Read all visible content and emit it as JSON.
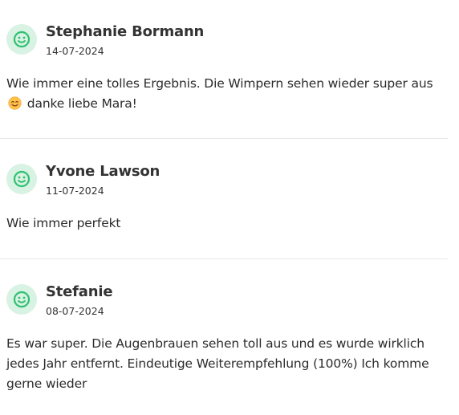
{
  "colors": {
    "avatar_bg": "#d8f2e3",
    "avatar_icon": "#2fc170",
    "text": "#2b2b2b",
    "divider": "#e6e6e6"
  },
  "reviews": [
    {
      "name": "Stephanie Bormann",
      "date": "14-07-2024",
      "avatar_icon": "smiley-face-icon",
      "text_before_emoji": "Wie immer eine tolles Ergebnis. Die Wimpern sehen wieder super aus",
      "emoji": "smiling-face-emoji",
      "text_after_emoji": "danke liebe Mara!"
    },
    {
      "name": "Yvone Lawson",
      "date": "11-07-2024",
      "avatar_icon": "smiley-face-icon",
      "text": "Wie immer perfekt"
    },
    {
      "name": "Stefanie",
      "date": "08-07-2024",
      "avatar_icon": "smiley-face-icon",
      "text": "Es war super. Die Augenbrauen sehen toll aus und es wurde wirklich jedes Jahr entfernt. Eindeutige Weiterempfehlung (100%) Ich komme gerne wieder"
    }
  ]
}
